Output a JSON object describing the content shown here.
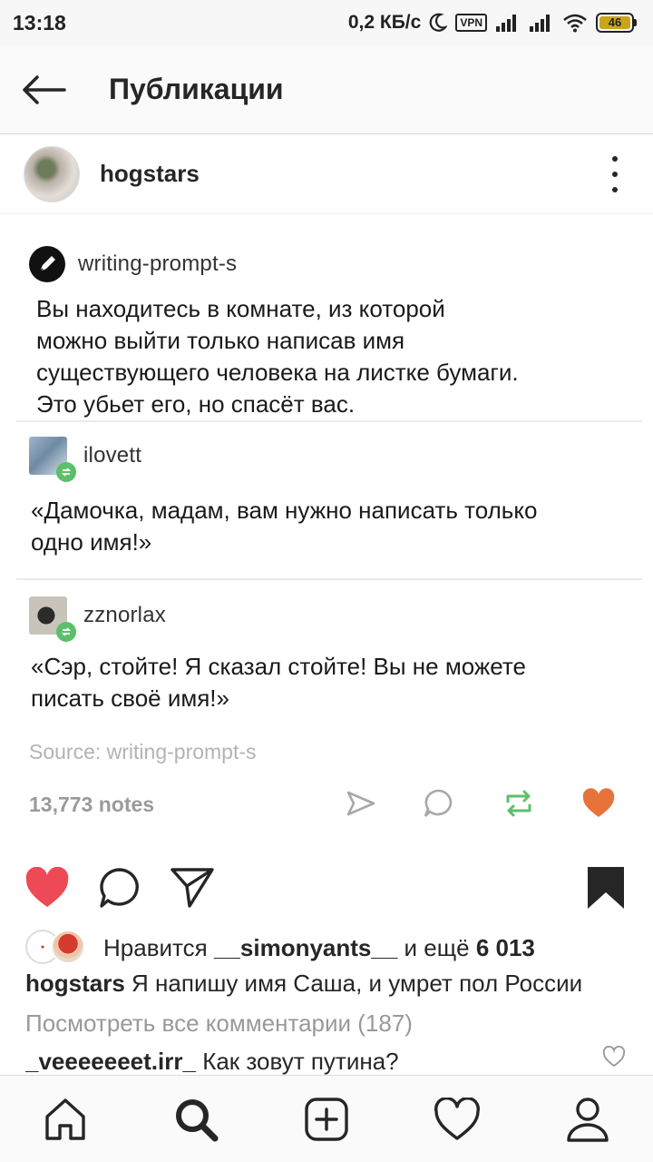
{
  "status_bar": {
    "time": "13:18",
    "speed": "0,2 КБ/с",
    "vpn": "VPN",
    "battery": "46",
    "icons": [
      "moon-icon",
      "signal-icon",
      "signal-icon",
      "wifi-icon",
      "battery-icon"
    ]
  },
  "appbar": {
    "title": "Публикации",
    "back_icon": "arrow-left-icon"
  },
  "post": {
    "username": "hogstars",
    "more_icon": "more-vertical-icon",
    "image": {
      "op": {
        "name": "writing-prompt-s",
        "lines": [
          "Вы находитесь в комнате, из которой",
          "можно выйти только написав имя",
          "существующего человека на листке бумаги.",
          "Это убьет его, но спасёт вас."
        ]
      },
      "reblog1": {
        "name": "ilovett",
        "lines": [
          "«Дамочка, мадам, вам нужно написать только",
          "одно имя!»"
        ]
      },
      "reblog2": {
        "name": "zznorlax",
        "lines": [
          "«Сэр, стойте! Я сказал стойте! Вы не можете",
          "писать своё имя!»"
        ]
      },
      "source": "Source: writing-prompt-s",
      "notes": "13,773 notes",
      "action_icons": [
        "share-icon",
        "comment-icon",
        "reblog-icon",
        "heart-icon"
      ],
      "colors": {
        "heart": "#e8733a",
        "reblog": "#5cbf6a"
      }
    },
    "actions": {
      "like_icon": "heart-filled-icon",
      "comment_icon": "comment-icon",
      "share_icon": "send-icon",
      "save_icon": "bookmark-filled-icon",
      "like_color": "#ed4956"
    },
    "likes": {
      "prefix": "Нравится",
      "user": "__simonyants__",
      "middle": "и ещё",
      "count": "6 013"
    },
    "caption": {
      "user": "hogstars",
      "text": "Я напишу имя Саша, и умрет пол России"
    },
    "view_comments": "Посмотреть все комментарии (187)",
    "comment": {
      "user": "_veeeeeeet.irr_",
      "text": "Как зовут путина?"
    }
  },
  "bottom_nav": {
    "items": [
      "home-icon",
      "search-icon",
      "add-post-icon",
      "activity-heart-icon",
      "profile-icon"
    ]
  }
}
